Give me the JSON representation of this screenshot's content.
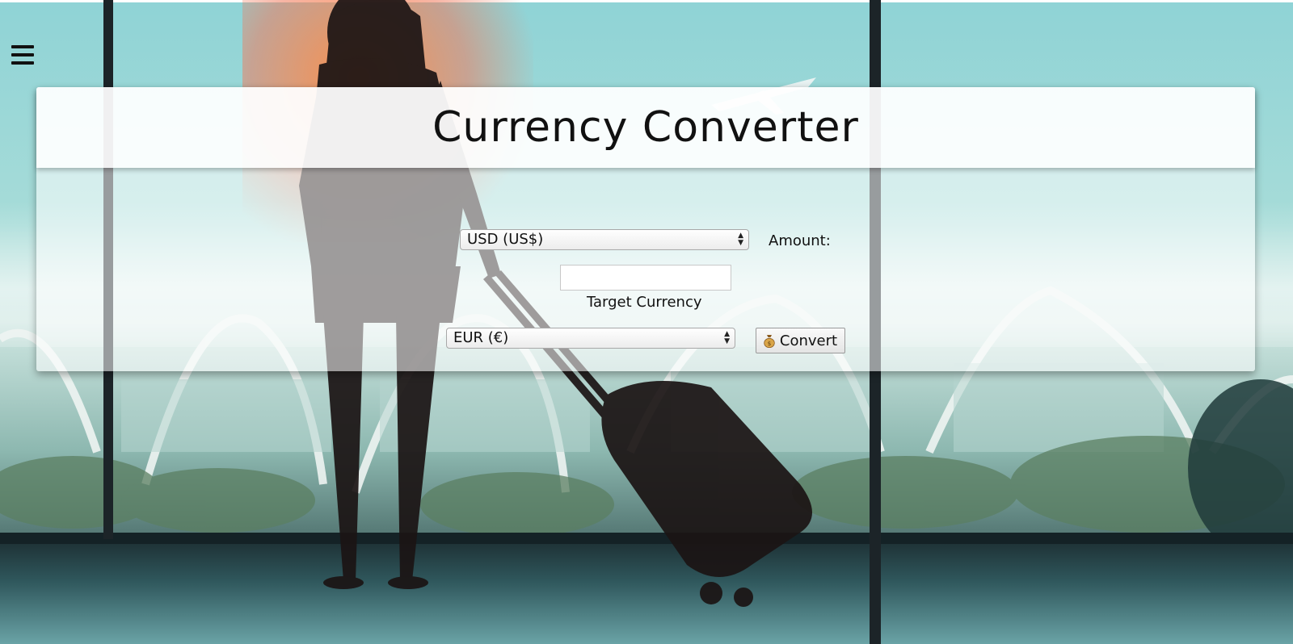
{
  "page": {
    "title": "Currency Converter"
  },
  "nav": {
    "menu_icon": "hamburger-menu-icon"
  },
  "form": {
    "source_currency": {
      "selected": "USD (US$)"
    },
    "amount_label": "Amount:",
    "amount_input": {
      "value": "",
      "placeholder": ""
    },
    "target_label": "Target Currency",
    "target_currency": {
      "selected": "EUR (€)"
    },
    "convert_button": {
      "label": "Convert",
      "icon": "money-bag-icon"
    }
  },
  "colors": {
    "panel": "#ffffff",
    "text": "#111111",
    "button_border": "#9a9a9a"
  }
}
